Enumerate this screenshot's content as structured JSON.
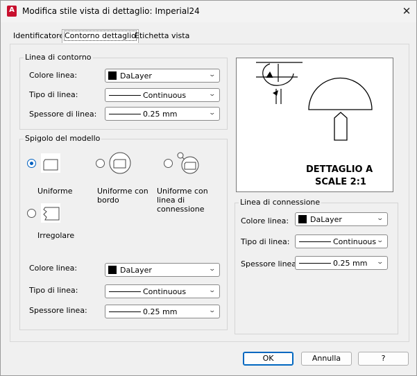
{
  "window": {
    "title": "Modifica stile vista di dettaglio: Imperial24",
    "close_glyph": "✕",
    "app_icon_glyph": "A"
  },
  "tabs": [
    {
      "label": "Identificatore",
      "active": false
    },
    {
      "label": "Contorno dettaglio",
      "active": true
    },
    {
      "label": "Etichetta vista",
      "active": false
    }
  ],
  "boundary": {
    "group_label": "Linea di contorno",
    "color_label": "Colore linea:",
    "color_value": "DaLayer",
    "type_label": "Tipo di linea:",
    "type_value": "Continuous",
    "weight_label": "Spessore di linea:",
    "weight_value": "0.25 mm"
  },
  "model_edge": {
    "group_label": "Spigolo del modello",
    "options": [
      {
        "label": "Uniforme",
        "selected": true
      },
      {
        "label": "Uniforme con bordo",
        "selected": false
      },
      {
        "label": "Uniforme con linea di connessione",
        "selected": false
      },
      {
        "label": "Irregolare",
        "selected": false
      }
    ],
    "color_label": "Colore linea:",
    "color_value": "DaLayer",
    "type_label": "Tipo di linea:",
    "type_value": "Continuous",
    "weight_label": "Spessore linea:",
    "weight_value": "0.25 mm"
  },
  "preview": {
    "line1": "DETTAGLIO A",
    "line2": "SCALE 2:1"
  },
  "connection": {
    "group_label": "Linea di connessione",
    "color_label": "Colore linea:",
    "color_value": "DaLayer",
    "type_label": "Tipo di linea:",
    "type_value": "Continuous",
    "weight_label": "Spessore linea:",
    "weight_value": "0.25 mm"
  },
  "buttons": {
    "ok": "OK",
    "cancel": "Annulla",
    "help": "?"
  },
  "colors": {
    "accent": "#0067c0",
    "app_icon": "#c8102e"
  }
}
